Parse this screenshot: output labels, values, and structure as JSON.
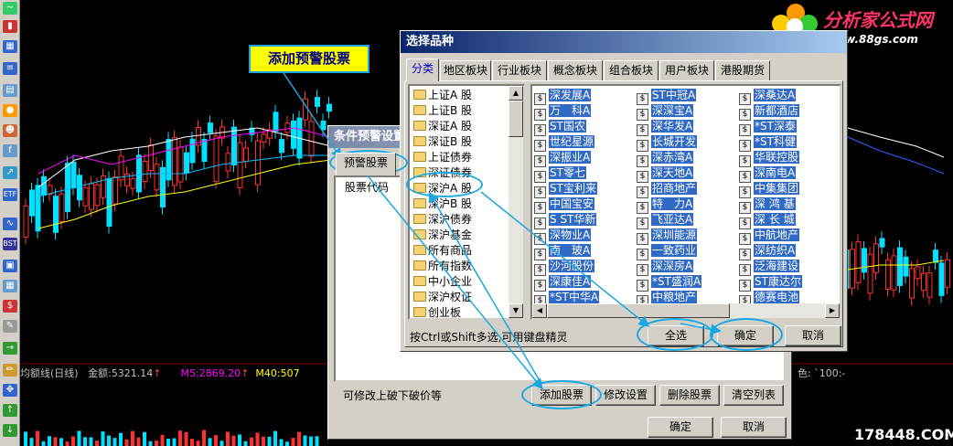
{
  "chart": {
    "indicator_label": "均额线(日线)",
    "amount_label": "金额:5321.14",
    "m5_label": "M5:2869.20",
    "m40_label": "M40:507",
    "right_fragment": "色: `100:-"
  },
  "callout": {
    "text": "添加预警股票"
  },
  "logo": {
    "title": "分析家公式网",
    "url": "www.88gs.com"
  },
  "watermark": "178448.COM",
  "cond_dialog": {
    "title": "条件预警设置",
    "tab_warn_stocks": "预警股票",
    "col_stock_code": "股票代码",
    "hint": "可修改上破下破价等",
    "add_button": "添加股票",
    "modify_button": "修改设置",
    "delete_button": "删除股票",
    "clear_button": "清空列表",
    "ok_button": "确定",
    "cancel_button": "取消"
  },
  "select_dialog": {
    "title": "选择品种",
    "tabs": [
      "分类",
      "地区板块",
      "行业板块",
      "概念板块",
      "组合板块",
      "用户板块",
      "港股期货"
    ],
    "categories": [
      "上证A 股",
      "上证B 股",
      "深证A 股",
      "深证B 股",
      "上证债券",
      "深证债券",
      "深沪A 股",
      "深沪B 股",
      "深沪债券",
      "深沪基金",
      "所有商品",
      "所有指数",
      "中小企业",
      "深沪权证",
      "创业板"
    ],
    "stocks_col1": [
      "深发展A",
      "万　科A",
      "ST国农",
      "世纪星源",
      "深振业A",
      "ST零七",
      "ST宝利来",
      "中国宝安",
      "S ST华新",
      "深物业A",
      "南　玻A",
      "沙河股份",
      "深康佳A",
      "*ST中华A"
    ],
    "stocks_col2": [
      "ST中冠A",
      "深深宝A",
      "深华发A",
      "长城开发",
      "深赤湾A",
      "深天地A",
      "招商地产",
      "特　力A",
      "飞亚达A",
      "深圳能源",
      "一致药业",
      "深深房A",
      "*ST盛润A",
      "中粮地产"
    ],
    "stocks_col3": [
      "深桑达A",
      "新都酒店",
      "*ST深泰",
      "*ST科健",
      "华联控股",
      "深南电A",
      "中集集团",
      "深 鸿 基",
      "深 长 城",
      "中航地产",
      "深纺织A",
      "泛海建设",
      "ST康达尔",
      "德赛电池"
    ],
    "hint": "按Ctrl或Shift多选,可用键盘精灵",
    "select_all_button": "全选",
    "ok_button": "确定",
    "cancel_button": "取消"
  },
  "colors": {
    "accent": "#1aa8e0",
    "titlebar": "#0a246a",
    "selection": "#316ac5"
  }
}
